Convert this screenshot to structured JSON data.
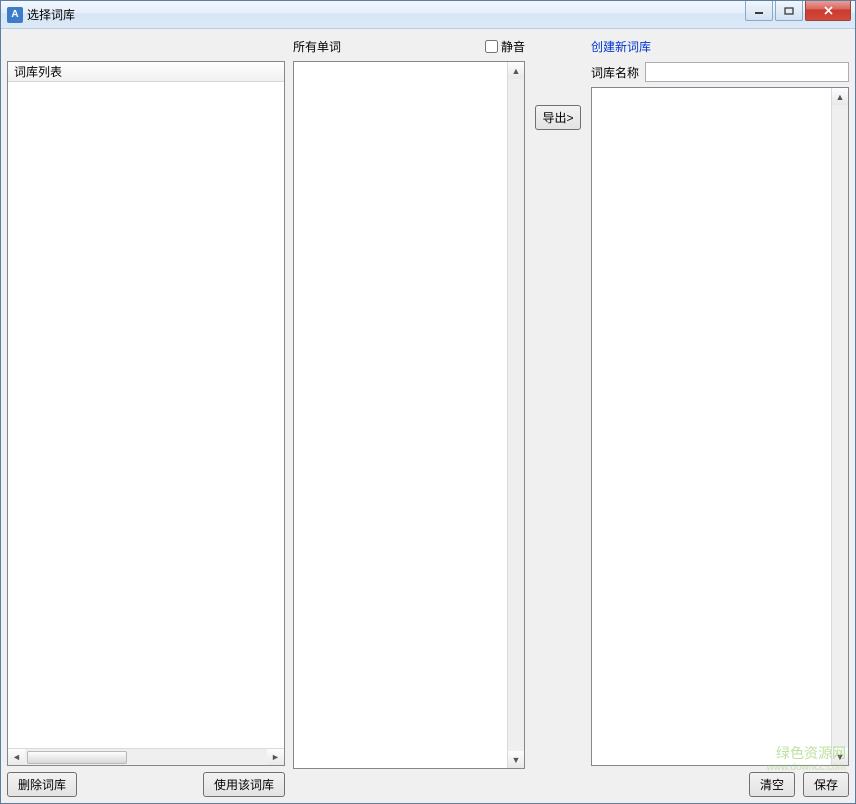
{
  "window": {
    "title": "选择词库"
  },
  "left": {
    "header": "词库列表",
    "delete_btn": "删除词库",
    "use_btn": "使用该词库"
  },
  "mid": {
    "label": "所有单词",
    "mute_label": "静音"
  },
  "export": {
    "btn": "导出>"
  },
  "right": {
    "create_link": "创建新词库",
    "name_label": "词库名称",
    "name_value": "",
    "clear_btn": "清空",
    "save_btn": "保存"
  },
  "watermark": {
    "line1": "绿色资源网",
    "line2": "www.downcc.com"
  }
}
